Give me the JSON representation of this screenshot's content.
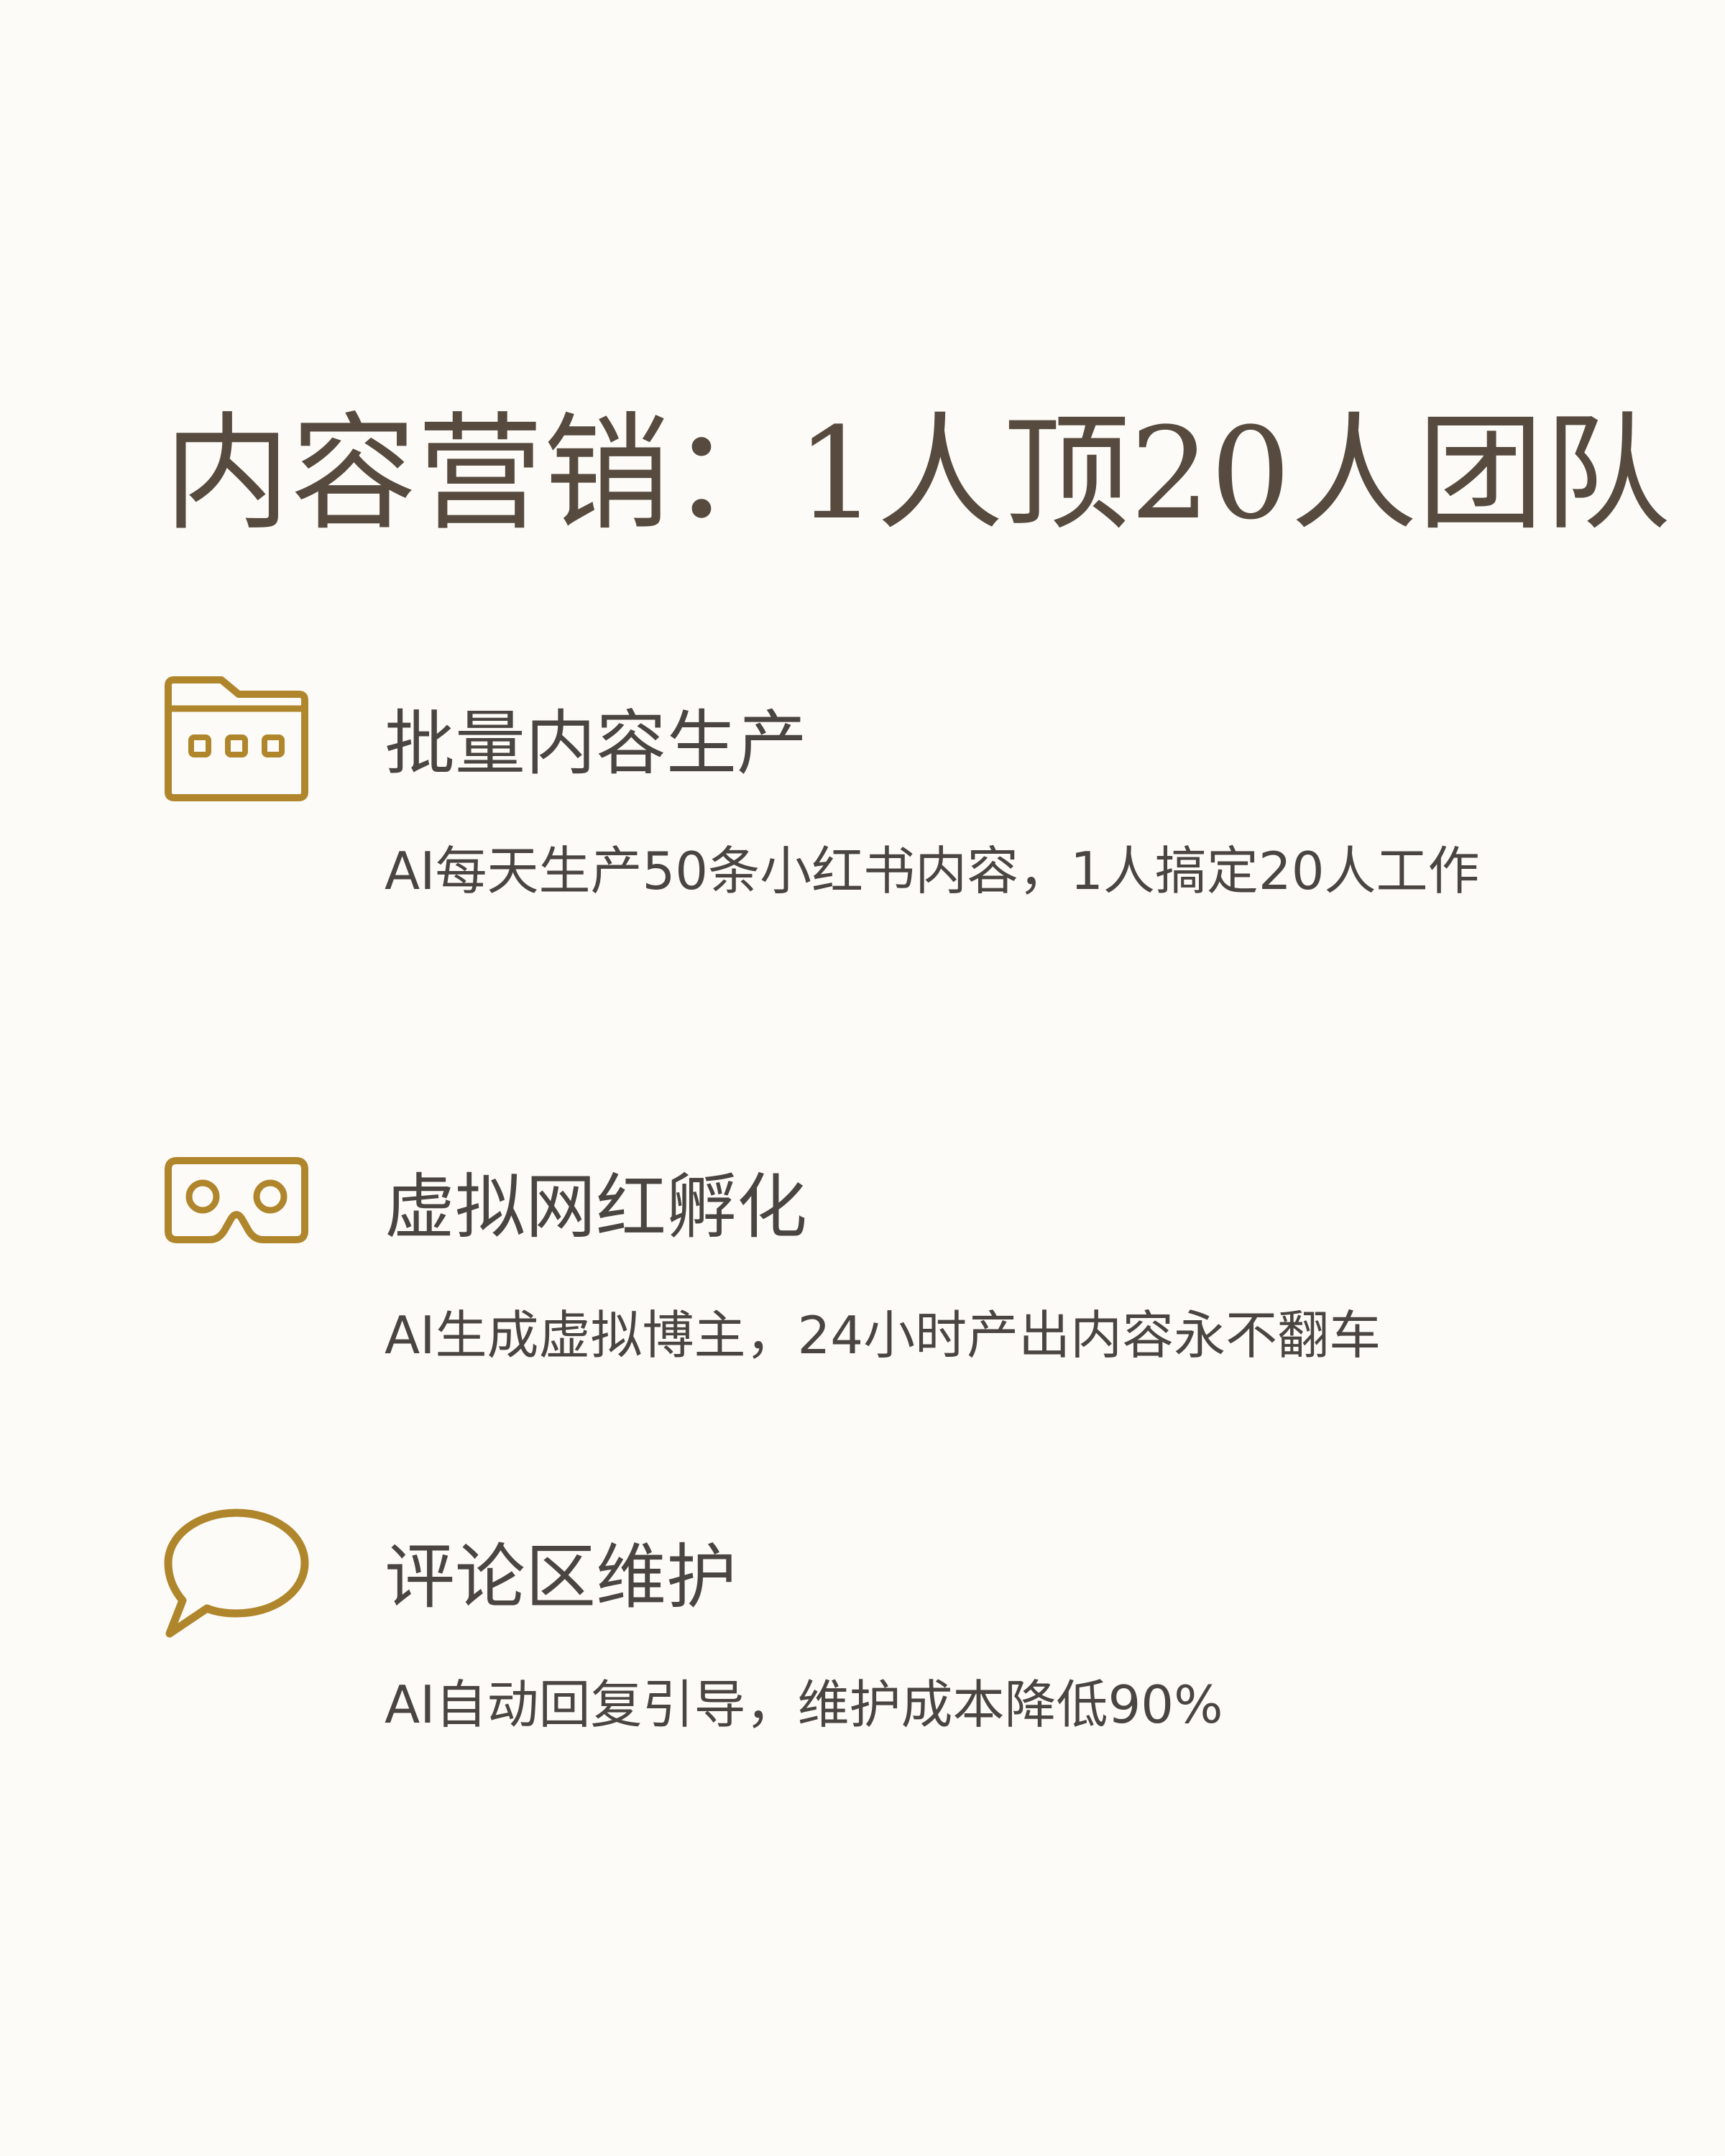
{
  "page": {
    "title": "内容营销：1人顶20人团队"
  },
  "colors": {
    "background": "#fdfbf8",
    "title": "#574b3f",
    "text": "#4a4540",
    "icon_accent": "#b0862c"
  },
  "features": [
    {
      "icon": "folder-icon",
      "title": "批量内容生产",
      "description": "AI每天生产50条小红书内容，1人搞定20人工作"
    },
    {
      "icon": "vr-headset-icon",
      "title": "虚拟网红孵化",
      "description": "AI生成虚拟博主，24小时产出内容永不翻车"
    },
    {
      "icon": "speech-bubble-icon",
      "title": "评论区维护",
      "description": "AI自动回复引导，维护成本降低90%"
    }
  ]
}
